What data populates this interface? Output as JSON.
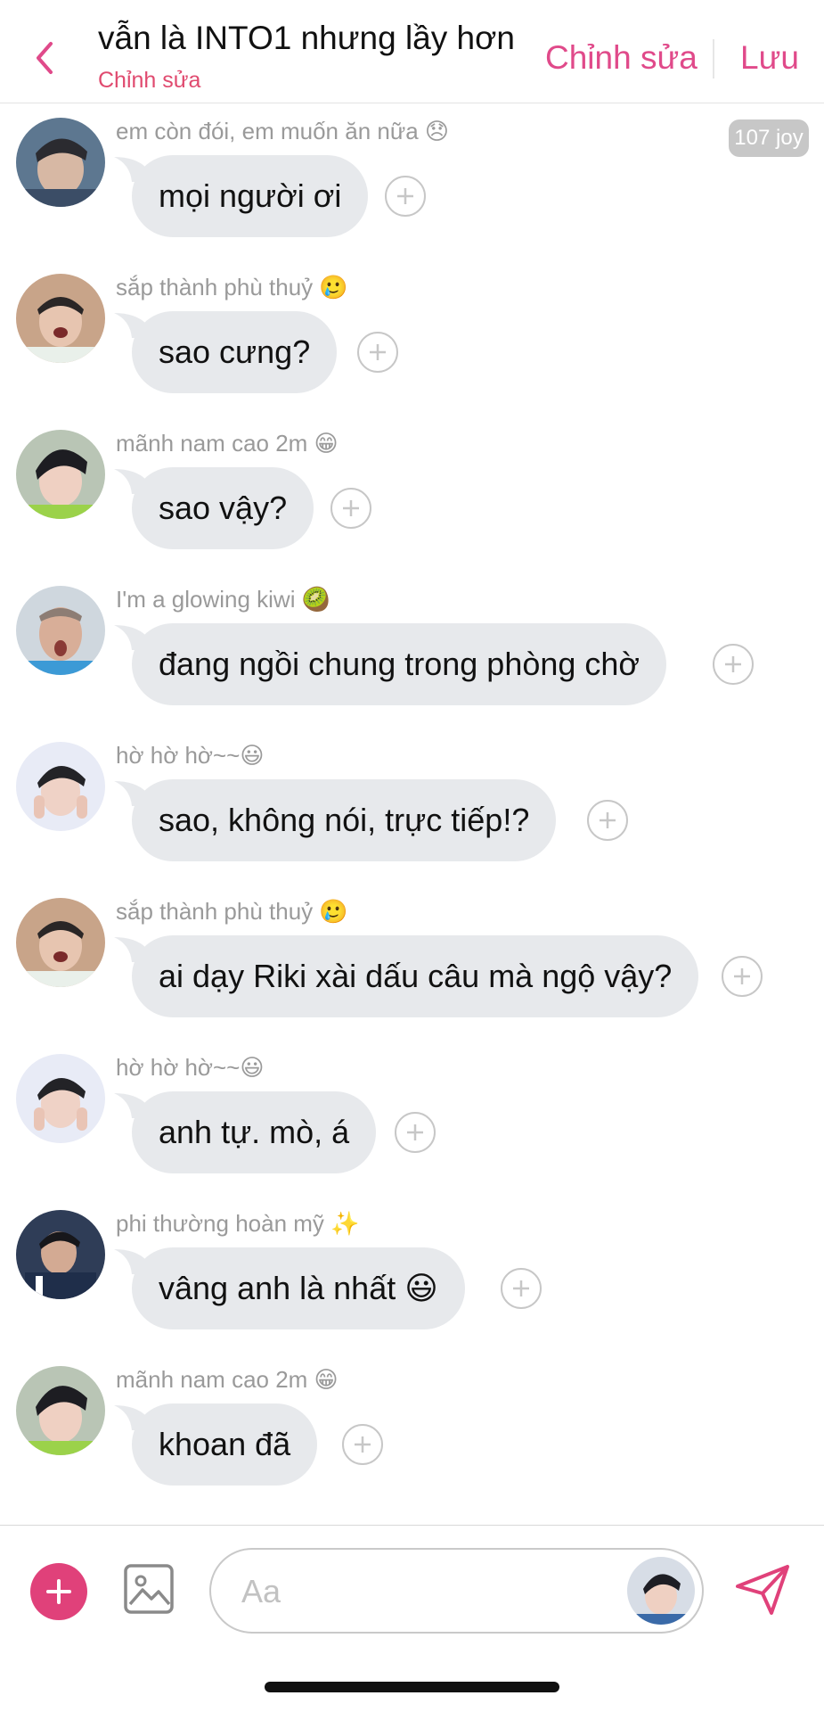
{
  "header": {
    "title": "vẫn là INTO1 nhưng lầy hơn",
    "subtitle": "Chỉnh sửa",
    "edit_label": "Chỉnh sửa",
    "save_label": "Lưu"
  },
  "joy_badge": "107 joy",
  "messages": [
    {
      "sender": "em còn đói, em muốn ăn nữa 😞",
      "text": "mọi người ơi"
    },
    {
      "sender": "sắp thành phù thuỷ 🥲",
      "text": "sao cưng?"
    },
    {
      "sender": "mãnh nam cao 2m 😁",
      "text": "sao vậy?"
    },
    {
      "sender": "I'm a glowing kiwi 🥝",
      "text": "đang ngồi chung trong phòng chờ"
    },
    {
      "sender": "hờ hờ hờ~~😃",
      "text": "sao, không nói, trực tiếp!?"
    },
    {
      "sender": "sắp thành phù thuỷ 🥲",
      "text": "ai dạy Riki xài dấu câu mà ngộ vậy?"
    },
    {
      "sender": "hờ hờ hờ~~😃",
      "text": "anh tự. mò, á"
    },
    {
      "sender": "phi thường hoàn mỹ ✨",
      "text": "vâng anh là nhất 😃"
    },
    {
      "sender": "mãnh nam cao 2m 😁",
      "text": "khoan đã"
    }
  ],
  "composer": {
    "placeholder": "Aa"
  },
  "colors": {
    "accent": "#e0417a",
    "bubble": "#e7e9ec",
    "sender_text": "#9a9a9a"
  },
  "icons": [
    "chevron-left-icon",
    "plus-icon",
    "image-icon",
    "send-icon"
  ]
}
